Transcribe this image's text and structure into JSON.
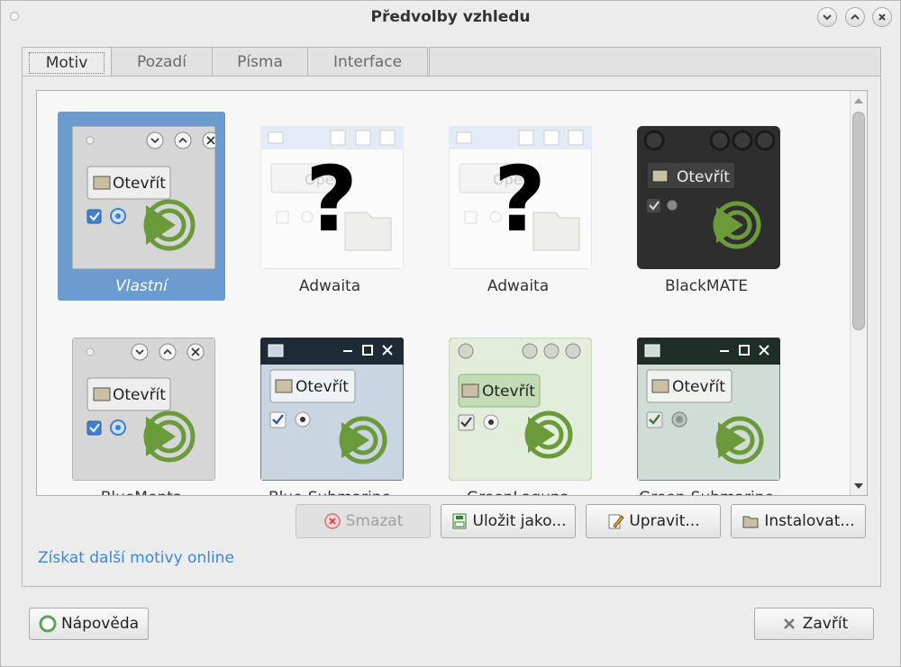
{
  "window": {
    "title": "Předvolby vzhledu"
  },
  "tabs": [
    {
      "label": "Motiv",
      "active": true
    },
    {
      "label": "Pozadí"
    },
    {
      "label": "Písma"
    },
    {
      "label": "Interface"
    }
  ],
  "themes": [
    {
      "name": "Vlastní",
      "selected": true,
      "preview_button": "Otevřít"
    },
    {
      "name": "Adwaita",
      "preview_button": "Ope"
    },
    {
      "name": "Adwaita",
      "preview_button": "Ope"
    },
    {
      "name": "BlackMATE",
      "preview_button": "Otevřít"
    },
    {
      "name": "BlueMenta",
      "preview_button": "Otevřít"
    },
    {
      "name": "Blue-Submarine",
      "preview_button": "Otevřít"
    },
    {
      "name": "GreenLaguna",
      "preview_button": "Otevřít"
    },
    {
      "name": "Green-Submarine",
      "preview_button": "Otevřít"
    }
  ],
  "actions": {
    "delete": "Smazat",
    "save_as": "Uložit jako...",
    "edit": "Upravit...",
    "install": "Instalovat..."
  },
  "more_themes_link": "Získat další motivy online",
  "footer": {
    "help": "Nápověda",
    "close": "Zavřít"
  },
  "colors": {
    "selection": "#6c9bd0",
    "link": "#3d87d8",
    "mint_green": "#6a9a3a"
  }
}
